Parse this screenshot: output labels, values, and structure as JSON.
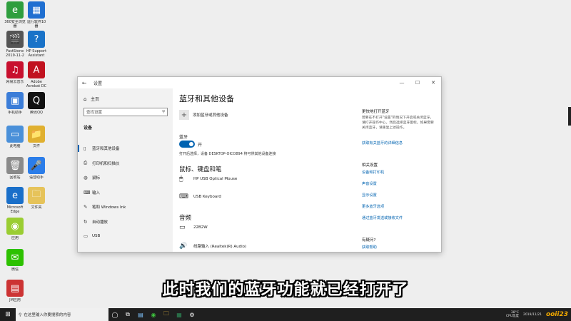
{
  "desktop": {
    "icons": [
      {
        "caption": "360安全浏览\n器",
        "color": "#2e9e3e",
        "glyph": "e"
      },
      {
        "caption": "运行软件10\n器",
        "color": "#1f6fd1",
        "glyph": "▦"
      },
      {
        "caption": "FastStone\n2019-11-2",
        "color": "#555555",
        "glyph": "🎬"
      },
      {
        "caption": "HP Support\nAssistant",
        "color": "#1a73c8",
        "glyph": "?"
      },
      {
        "caption": "网易云音乐",
        "color": "#c8102e",
        "glyph": "♫"
      },
      {
        "caption": "Adobe\nAcrobat DC",
        "color": "#c1121f",
        "glyph": "A"
      },
      {
        "caption": "手机助手",
        "color": "#3b7dd8",
        "glyph": "▣"
      },
      {
        "caption": "腾讯QQ",
        "color": "#111111",
        "glyph": "Q"
      },
      {
        "caption": "此电脑",
        "color": "#4a90d9",
        "glyph": "▭"
      },
      {
        "caption": "文件",
        "color": "#e0b030",
        "glyph": "📁"
      },
      {
        "caption": "回收站",
        "color": "#8a8a8a",
        "glyph": "🗑"
      },
      {
        "caption": "语音助手",
        "color": "#2b7de9",
        "glyph": "🎤"
      },
      {
        "caption": "Microsoft\nEdge",
        "color": "#1a6fc9",
        "glyph": "e"
      },
      {
        "caption": "文件夹",
        "color": "#e6c35a",
        "glyph": "🗀"
      },
      {
        "caption": "应用",
        "color": "#9acd32",
        "glyph": "◉"
      },
      {
        "caption": "微信",
        "color": "#2dc100",
        "glyph": "✉"
      },
      {
        "caption": "JM应用",
        "color": "#cc3333",
        "glyph": "▤"
      }
    ]
  },
  "window": {
    "title": "设置",
    "back_glyph": "←",
    "controls": [
      "—",
      "☐",
      "✕"
    ],
    "sidebar": {
      "home": "主页",
      "search_placeholder": "查找设置",
      "section": "设备",
      "items": [
        {
          "label": "蓝牙和其他设备",
          "icon": "▯",
          "active": true
        },
        {
          "label": "打印机和扫描仪",
          "icon": "⎙",
          "active": false
        },
        {
          "label": "鼠标",
          "icon": "◍",
          "active": false
        },
        {
          "label": "输入",
          "icon": "⌨",
          "active": false
        },
        {
          "label": "笔和 Windows Ink",
          "icon": "✎",
          "active": false
        },
        {
          "label": "自动播放",
          "icon": "↻",
          "active": false
        },
        {
          "label": "USB",
          "icon": "▭",
          "active": false
        }
      ]
    },
    "main": {
      "heading": "蓝牙和其他设备",
      "add_device": "添加蓝牙或其他设备",
      "bt_label": "蓝牙",
      "toggle_state": "开",
      "discoverable": "打开后选择，设备 DESKTOP-OICO894 将可供其他设备连接",
      "mouse_section": "鼠标、键盘和笔",
      "devices_input": [
        {
          "name": "HP USB Optical Mouse",
          "icon": "🖱"
        },
        {
          "name": "USB Keyboard",
          "icon": "⌨"
        }
      ],
      "audio_section": "音频",
      "devices_audio": [
        {
          "name": "22B2W",
          "icon": "▭"
        },
        {
          "name": "线路输入 (Realtek(R) Audio)",
          "icon": "🔊"
        }
      ]
    },
    "right": {
      "quick_heading": "更快地打开蓝牙",
      "quick_text": "若要在不打开\"设置\"的情况下开启或关闭蓝牙，请打开操作中心，然后选择蓝牙图标。如果需要关闭蓝牙，请重复上述操作。",
      "quick_link": "获取有关蓝牙的详细信息",
      "related_heading": "相关设置",
      "related_links": [
        "设备和打印机",
        "声音设置",
        "显示设置",
        "更多蓝牙选项",
        "通过蓝牙发送或接收文件"
      ],
      "help_heading": "有疑问?",
      "help_link": "获取帮助"
    }
  },
  "subtitle": "此时我们的蓝牙功能就已经打开了",
  "taskbar": {
    "start_glyph": "⊞",
    "search_placeholder": "在这里输入你要搜索的内容",
    "apps": [
      "◯",
      "⧉",
      "▤",
      "◉",
      "🗀",
      "▦",
      "⚙"
    ],
    "tray_temp": "38°C",
    "tray_cpu": "CPU温度",
    "tray_date": "2019/11/21",
    "logo_text": "ooii23"
  },
  "colors": {
    "accent": "#0063b1",
    "taskbar": "#1f1f1f",
    "sidebar": "#f2f2f2"
  }
}
